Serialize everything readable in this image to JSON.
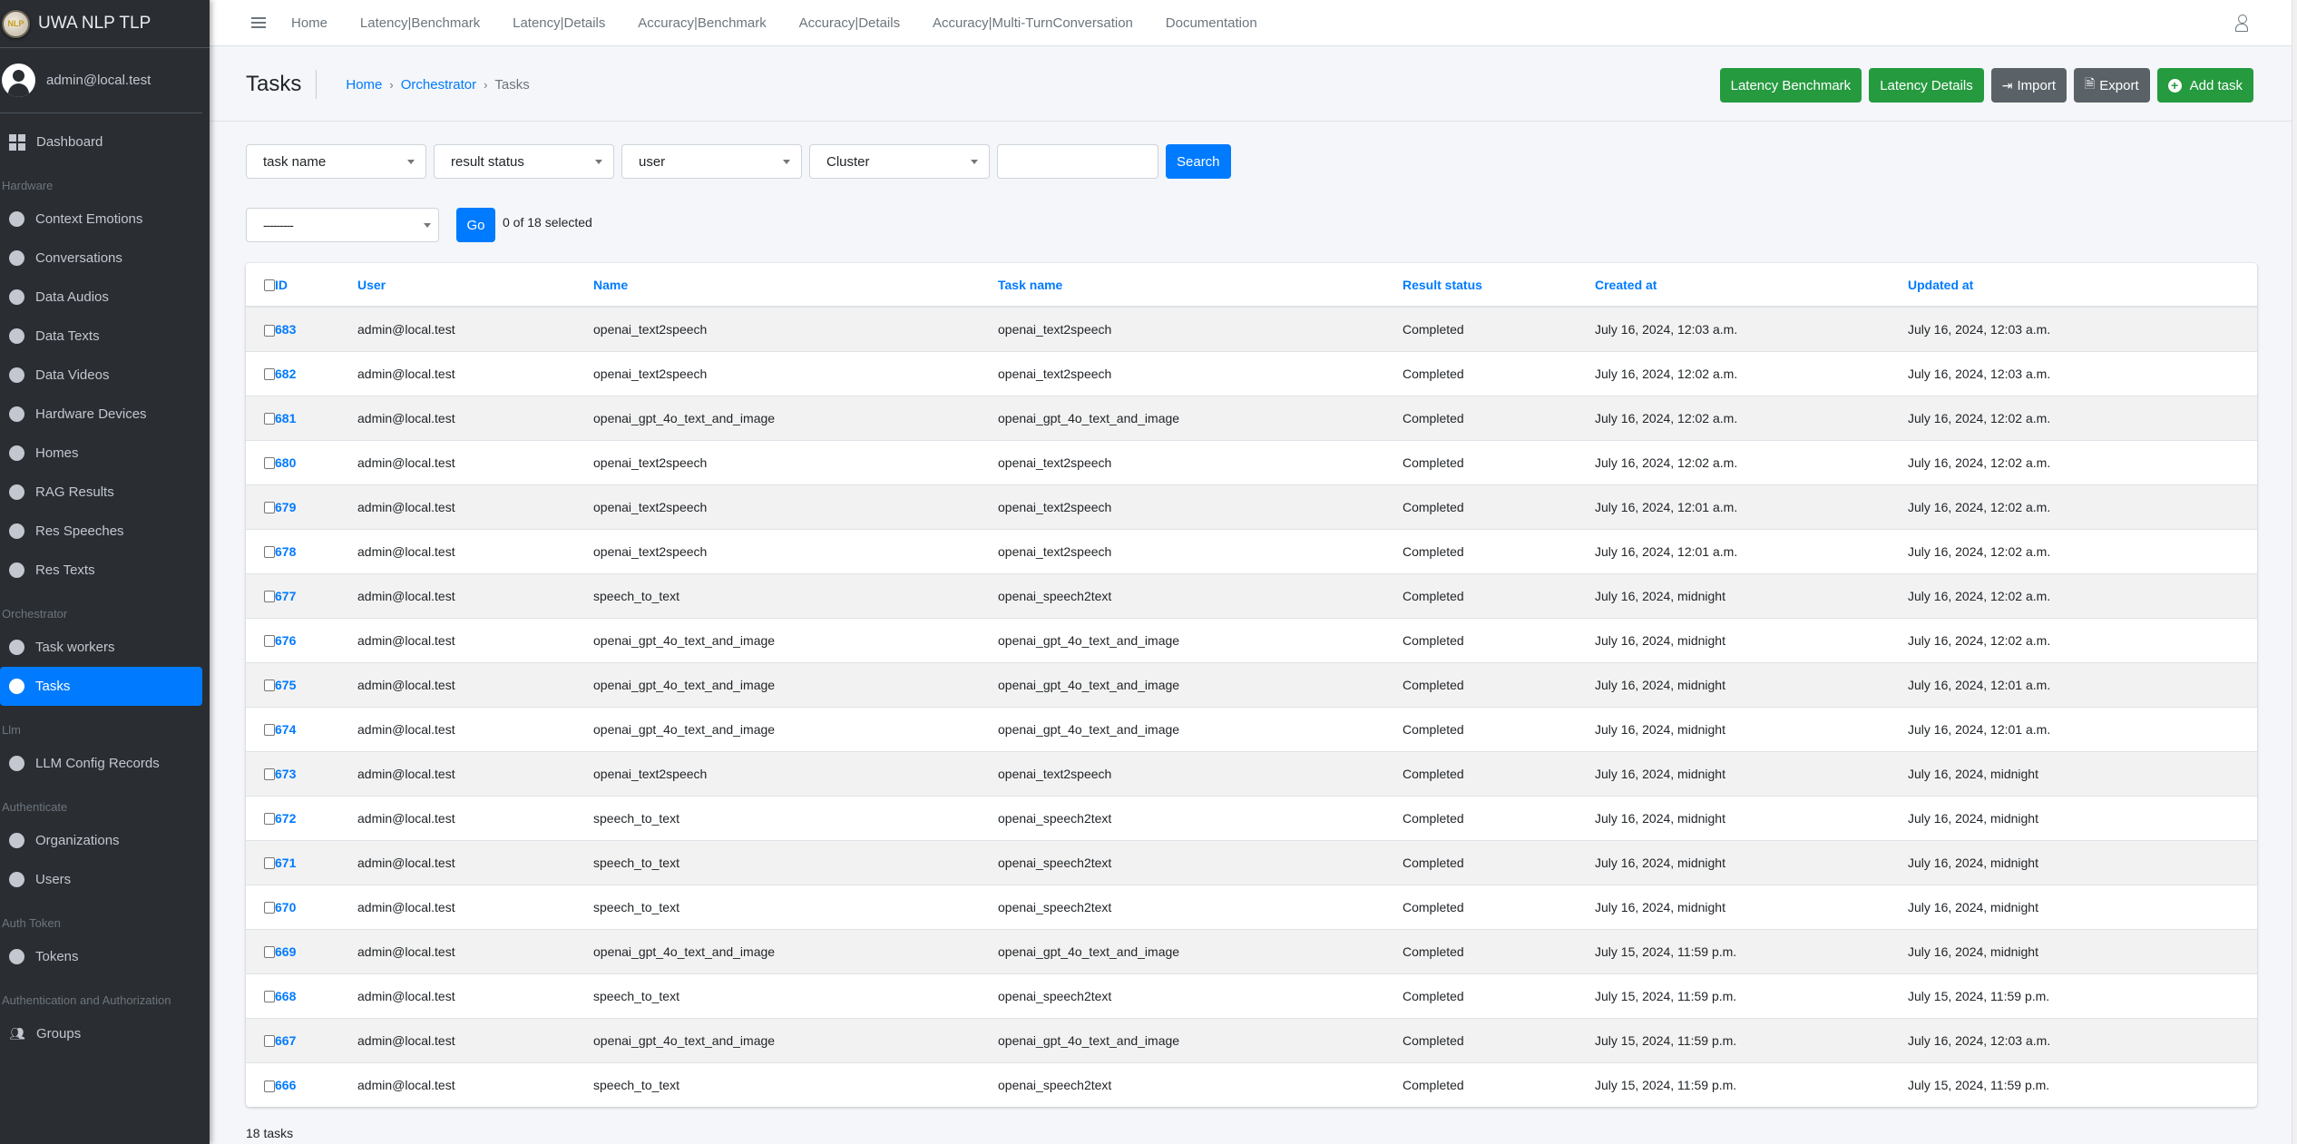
{
  "brand": {
    "logo_text": "NLP",
    "title": "UWA NLP TLP"
  },
  "user": {
    "email": "admin@local.test"
  },
  "sidebar": {
    "dashboard": "Dashboard",
    "sections": [
      {
        "header": "Hardware",
        "items": [
          "Context Emotions",
          "Conversations",
          "Data Audios",
          "Data Texts",
          "Data Videos",
          "Hardware Devices",
          "Homes",
          "RAG Results",
          "Res Speeches",
          "Res Texts"
        ]
      },
      {
        "header": "Orchestrator",
        "items": [
          "Task workers",
          "Tasks"
        ]
      },
      {
        "header": "Llm",
        "items": [
          "LLM Config Records"
        ]
      },
      {
        "header": "Authenticate",
        "items": [
          "Organizations",
          "Users"
        ]
      },
      {
        "header": "Auth Token",
        "items": [
          "Tokens"
        ]
      },
      {
        "header": "Authentication and Authorization",
        "items": [
          "Groups"
        ]
      }
    ],
    "active_item": "Tasks"
  },
  "topnav": {
    "menu_icon": "hamburger-icon",
    "links": [
      "Home",
      "Latency|Benchmark",
      "Latency|Details",
      "Accuracy|Benchmark",
      "Accuracy|Details",
      "Accuracy|Multi-TurnConversation",
      "Documentation"
    ],
    "user_icon": "user-icon"
  },
  "page": {
    "title": "Tasks",
    "breadcrumb": [
      "Home",
      "Orchestrator",
      "Tasks"
    ],
    "breadcrumb_separator": "›"
  },
  "actions": {
    "latency_benchmark": "Latency Benchmark",
    "latency_details": "Latency Details",
    "import": "Import",
    "export": "Export",
    "add_task": "Add task"
  },
  "filters": {
    "task_name": "task name",
    "result_status": "result status",
    "user": "user",
    "cluster": "Cluster",
    "search_value": "",
    "search_button": "Search"
  },
  "bulk": {
    "action_selected": "---------",
    "go": "Go",
    "selected_text": "0 of 18 selected"
  },
  "table": {
    "headers": [
      "ID",
      "User",
      "Name",
      "Task name",
      "Result status",
      "Created at",
      "Updated at"
    ],
    "rows": [
      [
        "683",
        "admin@local.test",
        "openai_text2speech",
        "openai_text2speech",
        "Completed",
        "July 16, 2024, 12:03 a.m.",
        "July 16, 2024, 12:03 a.m."
      ],
      [
        "682",
        "admin@local.test",
        "openai_text2speech",
        "openai_text2speech",
        "Completed",
        "July 16, 2024, 12:02 a.m.",
        "July 16, 2024, 12:03 a.m."
      ],
      [
        "681",
        "admin@local.test",
        "openai_gpt_4o_text_and_image",
        "openai_gpt_4o_text_and_image",
        "Completed",
        "July 16, 2024, 12:02 a.m.",
        "July 16, 2024, 12:02 a.m."
      ],
      [
        "680",
        "admin@local.test",
        "openai_text2speech",
        "openai_text2speech",
        "Completed",
        "July 16, 2024, 12:02 a.m.",
        "July 16, 2024, 12:02 a.m."
      ],
      [
        "679",
        "admin@local.test",
        "openai_text2speech",
        "openai_text2speech",
        "Completed",
        "July 16, 2024, 12:01 a.m.",
        "July 16, 2024, 12:02 a.m."
      ],
      [
        "678",
        "admin@local.test",
        "openai_text2speech",
        "openai_text2speech",
        "Completed",
        "July 16, 2024, 12:01 a.m.",
        "July 16, 2024, 12:02 a.m."
      ],
      [
        "677",
        "admin@local.test",
        "speech_to_text",
        "openai_speech2text",
        "Completed",
        "July 16, 2024, midnight",
        "July 16, 2024, 12:02 a.m."
      ],
      [
        "676",
        "admin@local.test",
        "openai_gpt_4o_text_and_image",
        "openai_gpt_4o_text_and_image",
        "Completed",
        "July 16, 2024, midnight",
        "July 16, 2024, 12:02 a.m."
      ],
      [
        "675",
        "admin@local.test",
        "openai_gpt_4o_text_and_image",
        "openai_gpt_4o_text_and_image",
        "Completed",
        "July 16, 2024, midnight",
        "July 16, 2024, 12:01 a.m."
      ],
      [
        "674",
        "admin@local.test",
        "openai_gpt_4o_text_and_image",
        "openai_gpt_4o_text_and_image",
        "Completed",
        "July 16, 2024, midnight",
        "July 16, 2024, 12:01 a.m."
      ],
      [
        "673",
        "admin@local.test",
        "openai_text2speech",
        "openai_text2speech",
        "Completed",
        "July 16, 2024, midnight",
        "July 16, 2024, midnight"
      ],
      [
        "672",
        "admin@local.test",
        "speech_to_text",
        "openai_speech2text",
        "Completed",
        "July 16, 2024, midnight",
        "July 16, 2024, midnight"
      ],
      [
        "671",
        "admin@local.test",
        "speech_to_text",
        "openai_speech2text",
        "Completed",
        "July 16, 2024, midnight",
        "July 16, 2024, midnight"
      ],
      [
        "670",
        "admin@local.test",
        "speech_to_text",
        "openai_speech2text",
        "Completed",
        "July 16, 2024, midnight",
        "July 16, 2024, midnight"
      ],
      [
        "669",
        "admin@local.test",
        "openai_gpt_4o_text_and_image",
        "openai_gpt_4o_text_and_image",
        "Completed",
        "July 15, 2024, 11:59 p.m.",
        "July 16, 2024, midnight"
      ],
      [
        "668",
        "admin@local.test",
        "speech_to_text",
        "openai_speech2text",
        "Completed",
        "July 15, 2024, 11:59 p.m.",
        "July 15, 2024, 11:59 p.m."
      ],
      [
        "667",
        "admin@local.test",
        "openai_gpt_4o_text_and_image",
        "openai_gpt_4o_text_and_image",
        "Completed",
        "July 15, 2024, 11:59 p.m.",
        "July 16, 2024, 12:03 a.m."
      ],
      [
        "666",
        "admin@local.test",
        "speech_to_text",
        "openai_speech2text",
        "Completed",
        "July 15, 2024, 11:59 p.m.",
        "July 15, 2024, 11:59 p.m."
      ]
    ],
    "footer_count": "18 tasks"
  },
  "colors": {
    "primary": "#007bff",
    "success": "#259a3f",
    "secondary": "#5a6268",
    "sidebar_bg": "#2a2d32"
  }
}
